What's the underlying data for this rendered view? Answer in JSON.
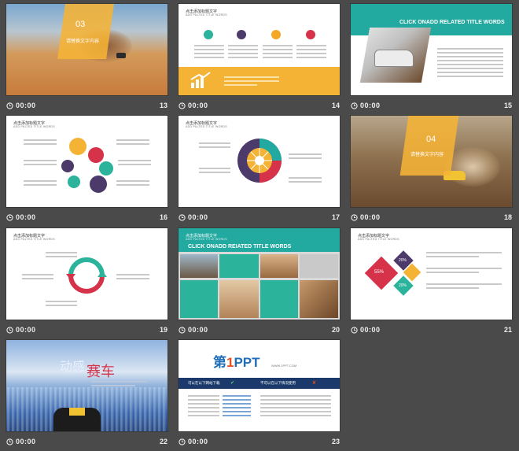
{
  "slides": [
    {
      "num": "13",
      "time": "00:00",
      "badge_num": "03",
      "badge_text": "请替换文字内容"
    },
    {
      "num": "14",
      "time": "00:00",
      "title": "点击添加标题文字",
      "subtitle": "ADD PALTED TITLE WORDS"
    },
    {
      "num": "15",
      "time": "00:00",
      "heading": "CLICK ONADD RELATED TITLE WORDS",
      "side_title": "点击添加标题文字，单击此文字即可，全面提高和增加效率方法"
    },
    {
      "num": "16",
      "time": "00:00",
      "title": "点击添加标题文字",
      "subtitle": "ADD PALTED TITLE WORDS"
    },
    {
      "num": "17",
      "time": "00:00",
      "title": "点击添加标题文字",
      "subtitle": "ADD PALTED TITLE WORDS"
    },
    {
      "num": "18",
      "time": "00:00",
      "badge_num": "04",
      "badge_text": "请替换文字内容"
    },
    {
      "num": "19",
      "time": "00:00",
      "title": "点击添加标题文字",
      "subtitle": "ADD PALTED TITLE WORDS"
    },
    {
      "num": "20",
      "time": "00:00",
      "title": "点击添加标题文字",
      "subtitle": "ADD PALTED TITLE WORDS",
      "heading": "CLICK ONADD REIATED TITLE WORDS"
    },
    {
      "num": "21",
      "time": "00:00",
      "title": "点击添加标题文字",
      "subtitle": "ADD PALTED TITLE WORDS",
      "p1": "55%",
      "p2": "20%",
      "p3": "20%"
    },
    {
      "num": "22",
      "time": "00:00",
      "title_a": "动感",
      "title_b": "赛车"
    },
    {
      "num": "23",
      "time": "00:00",
      "logo_a": "第",
      "logo_b": "1",
      "logo_c": "PPT",
      "url": "WWW.1PPT.COM",
      "col1": "可以在以下网站下载",
      "col2": "不可以在以下情况使用"
    }
  ],
  "colors": {
    "orange": "#f5b335",
    "teal": "#22a9a0",
    "purple": "#4c3a6b",
    "red": "#d6334a",
    "green": "#2bb39b"
  }
}
